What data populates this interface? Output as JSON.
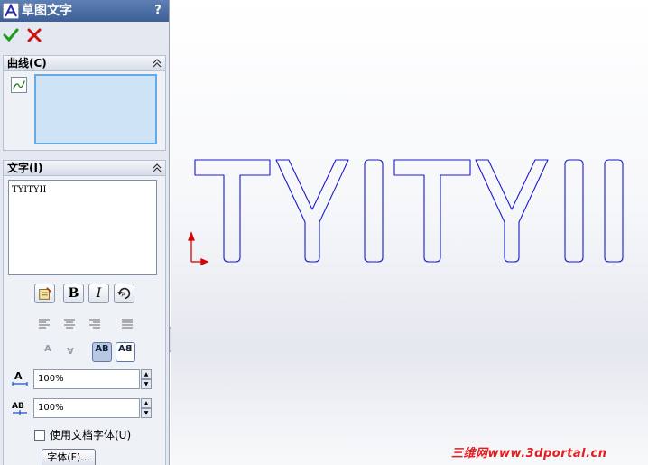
{
  "panel": {
    "title": "草图文字",
    "help_label": "?",
    "accent_color": "#3d5f96"
  },
  "curves_group": {
    "header": "曲线(C)",
    "icon": "curve-icon"
  },
  "text_group": {
    "header": "文字(I)",
    "text_value": "TYITYII",
    "format_buttons": {
      "bold": "B",
      "italic": "I"
    },
    "flip_buttons": {
      "vertical": "A",
      "horizontal": "A",
      "lr1": "AB",
      "lr2": "BA"
    },
    "width_factor": "100%",
    "spacing": "100%",
    "use_doc_font_label": "使用文档字体(U)",
    "use_doc_font_checked": false,
    "font_button": "字体(F)..."
  },
  "graphics": {
    "sketch_text": "TYITYII",
    "sketch_color": "#1a1acc",
    "origin_color": "#dd0000",
    "watermark": "三维网www.3dportal.cn"
  }
}
